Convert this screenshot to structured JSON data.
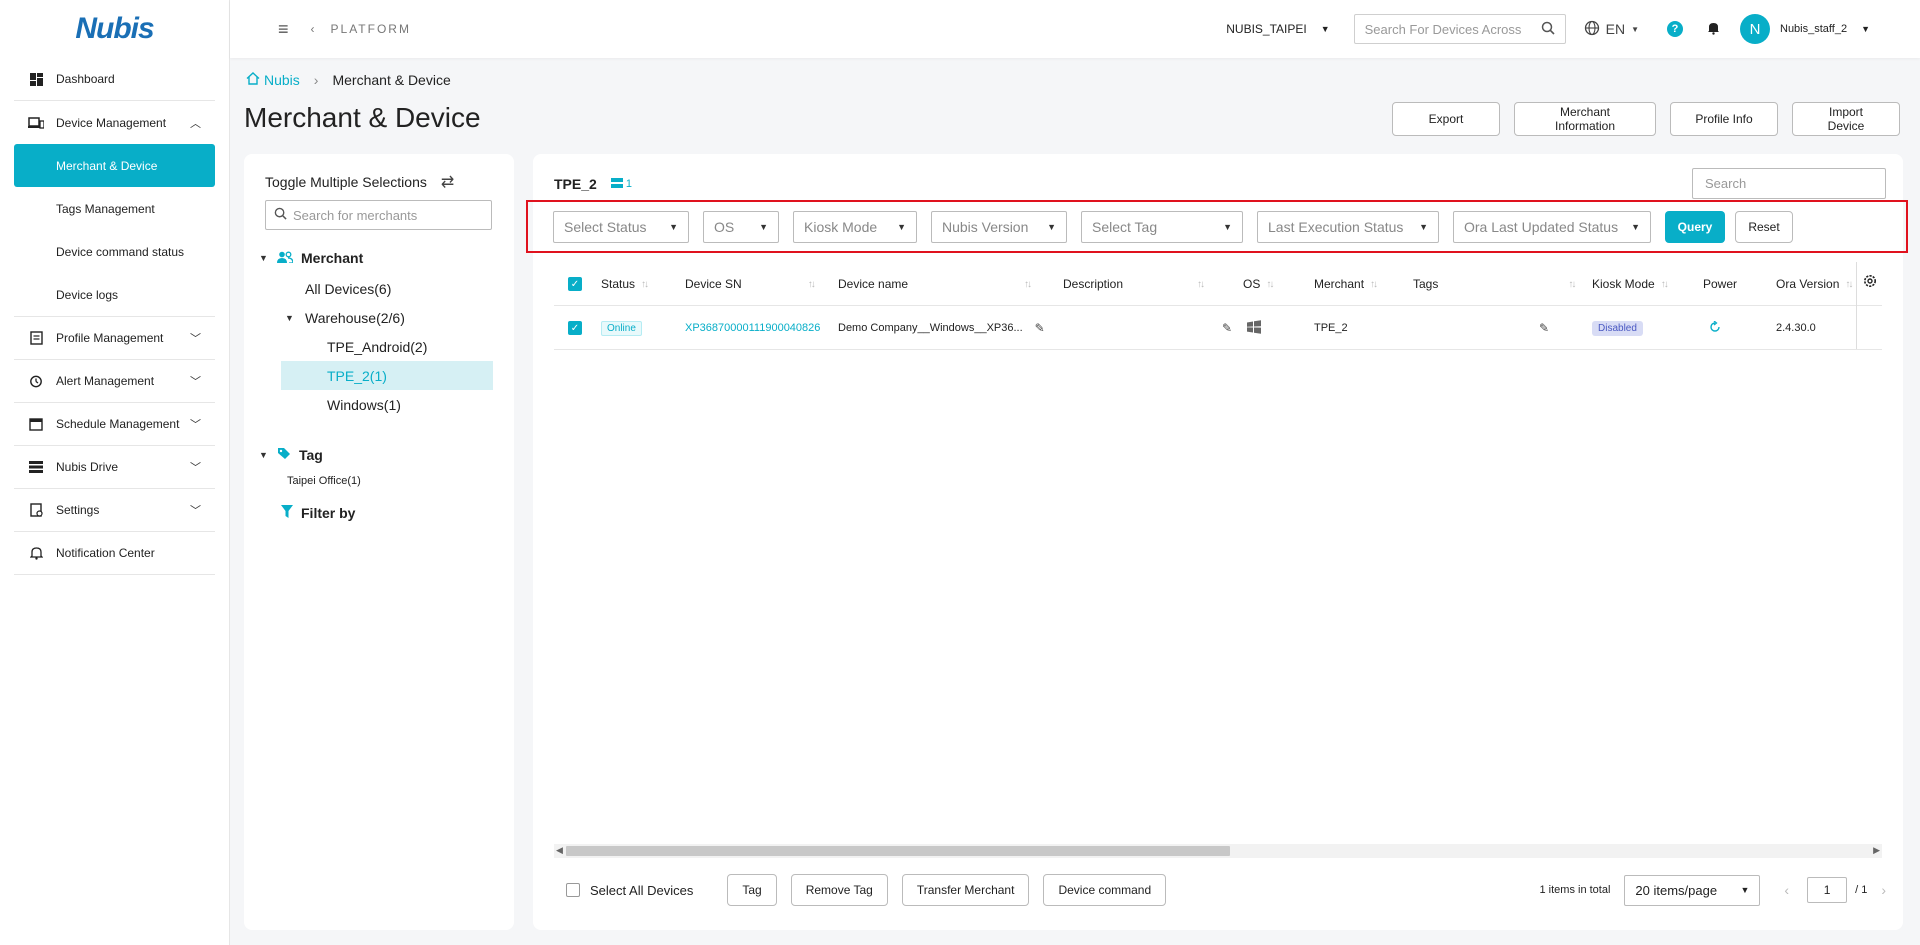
{
  "app": {
    "logo_text": "Nubis",
    "platform_label": "PLATFORM",
    "org": "NUBIS_TAIPEI",
    "search_placeholder": "Search For Devices Across",
    "lang": "EN",
    "help": "?",
    "avatar_initial": "N",
    "username": "Nubis_staff_2"
  },
  "sidebar": {
    "dashboard": "Dashboard",
    "device_management": "Device Management",
    "sub": {
      "merchant_device": "Merchant & Device",
      "tags": "Tags Management",
      "command_status": "Device command status",
      "logs": "Device logs"
    },
    "profile": "Profile Management",
    "alert": "Alert Management",
    "schedule": "Schedule Management",
    "drive": "Nubis Drive",
    "settings": "Settings",
    "notification": "Notification Center"
  },
  "breadcrumb": {
    "home": "Nubis",
    "sep": "›",
    "current": "Merchant & Device"
  },
  "page": {
    "title": "Merchant & Device",
    "actions": {
      "export": "Export",
      "merchant_info": "Merchant Information",
      "profile_info": "Profile Info",
      "import": "Import Device"
    }
  },
  "left_panel": {
    "toggle": "Toggle Multiple Selections",
    "search_placeholder": "Search for merchants",
    "merchant_header": "Merchant",
    "all_devices": "All Devices(6)",
    "warehouse": "Warehouse(2/6)",
    "tpe_android": "TPE_Android(2)",
    "tpe_2": "TPE_2(1)",
    "windows": "Windows(1)",
    "tag_header": "Tag",
    "tag_taipei": "Taipei Office(1)",
    "filter_by": "Filter by"
  },
  "right_panel": {
    "title": "TPE_2",
    "count": "1",
    "search_placeholder": "Search",
    "filters": {
      "status": "Select Status",
      "os": "OS",
      "kiosk": "Kiosk Mode",
      "version": "Nubis Version",
      "tag": "Select Tag",
      "last_exec": "Last Execution Status",
      "ora_updated": "Ora Last Updated Status",
      "query": "Query",
      "reset": "Reset"
    },
    "columns": {
      "status": "Status",
      "sn": "Device SN",
      "name": "Device name",
      "description": "Description",
      "os": "OS",
      "merchant": "Merchant",
      "tags": "Tags",
      "kiosk": "Kiosk Mode",
      "power": "Power",
      "ora_version": "Ora Version"
    },
    "rows": [
      {
        "status": "Online",
        "sn": "XP36870000111900040826",
        "name": "Demo Company__Windows__XP36...",
        "merchant": "TPE_2",
        "kiosk": "Disabled",
        "ora_version": "2.4.30.0"
      }
    ],
    "footer": {
      "select_all": "Select All Devices",
      "tag": "Tag",
      "remove_tag": "Remove Tag",
      "transfer": "Transfer Merchant",
      "command": "Device command",
      "total": "1 items in total",
      "page_size": "20 items/page",
      "page": "1",
      "pages": "/ 1"
    }
  },
  "colors": {
    "accent": "#08aec8",
    "highlight_border": "#e0121e",
    "disabled_badge": "#d8dcf5"
  }
}
